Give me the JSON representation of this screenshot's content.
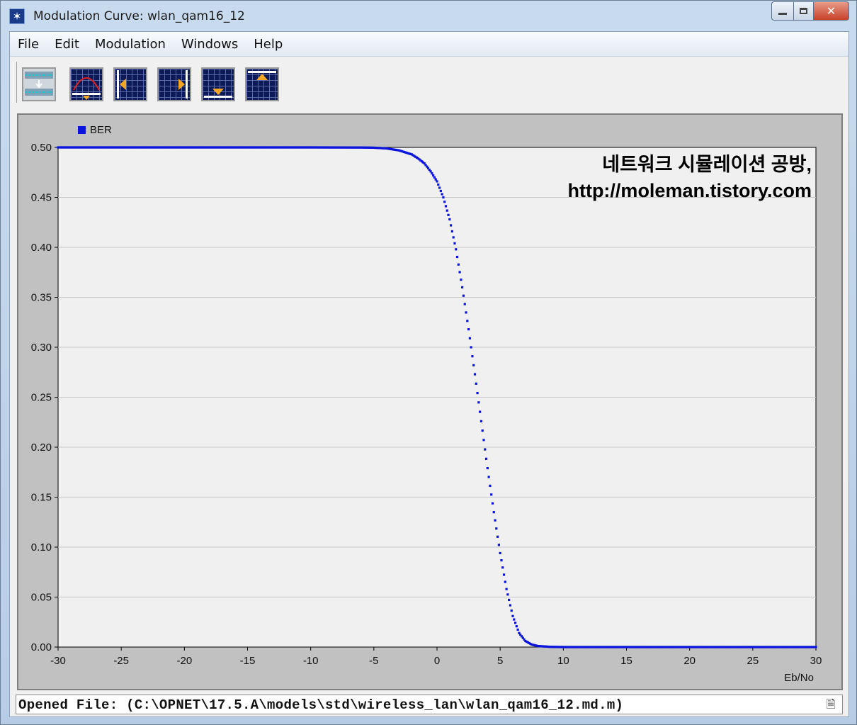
{
  "window": {
    "title": "Modulation Curve: wlan_qam16_12",
    "close_glyph": "✕"
  },
  "menu": [
    "File",
    "Edit",
    "Modulation",
    "Windows",
    "Help"
  ],
  "toolbar": {
    "buttons": [
      {
        "name": "modulation-function-button",
        "icon": "function-icon"
      },
      {
        "name": "fit-curve-button",
        "icon": "curve-fit-icon"
      },
      {
        "name": "shift-left-button",
        "icon": "arrow-left-icon"
      },
      {
        "name": "shift-right-button",
        "icon": "arrow-right-icon"
      },
      {
        "name": "shift-down-button",
        "icon": "arrow-down-icon"
      },
      {
        "name": "shift-up-button",
        "icon": "arrow-up-icon"
      }
    ]
  },
  "watermark": {
    "line1": "네트워크 시뮬레이션 공방,",
    "line2": "http://moleman.tistory.com"
  },
  "chart_data": {
    "type": "scatter",
    "legend": [
      "BER"
    ],
    "legend_placement": "top-left",
    "xlabel": "Eb/No",
    "ylabel": "",
    "xlim": [
      -30,
      30
    ],
    "ylim": [
      0,
      0.5
    ],
    "xticks": [
      -30,
      -25,
      -20,
      -15,
      -10,
      -5,
      0,
      5,
      10,
      15,
      20,
      25,
      30
    ],
    "yticks": [
      0.0,
      0.05,
      0.1,
      0.15,
      0.2,
      0.25,
      0.3,
      0.35,
      0.4,
      0.45,
      0.5
    ],
    "ytick_labels": [
      "0.00",
      "0.05",
      "0.10",
      "0.15",
      "0.20",
      "0.25",
      "0.30",
      "0.35",
      "0.40",
      "0.45",
      "0.50"
    ],
    "xtick_labels": [
      "-30",
      "-25",
      "-20",
      "-15",
      "-10",
      "-5",
      "0",
      "5",
      "10",
      "15",
      "20",
      "25",
      "30"
    ],
    "grid": "horizontal",
    "series": [
      {
        "name": "BER",
        "color": "#0a14dc",
        "x": [
          -30,
          -10,
          -6,
          -5,
          -4,
          -3,
          -2,
          -1.5,
          -1,
          -0.5,
          0,
          0.5,
          1,
          1.5,
          2,
          2.5,
          3,
          3.5,
          4,
          4.5,
          5,
          5.5,
          6,
          6.5,
          7,
          7.5,
          8,
          9,
          10,
          30
        ],
        "y": [
          0.5,
          0.5,
          0.4999,
          0.4997,
          0.499,
          0.497,
          0.493,
          0.489,
          0.484,
          0.476,
          0.466,
          0.45,
          0.428,
          0.398,
          0.36,
          0.318,
          0.273,
          0.226,
          0.179,
          0.135,
          0.094,
          0.058,
          0.031,
          0.014,
          0.006,
          0.0025,
          0.001,
          0.0002,
          0.0,
          0.0
        ]
      }
    ]
  },
  "status": {
    "text": "Opened File: (C:\\OPNET\\17.5.A\\models\\std\\wireless_lan\\wlan_qam16_12.md.m)"
  }
}
